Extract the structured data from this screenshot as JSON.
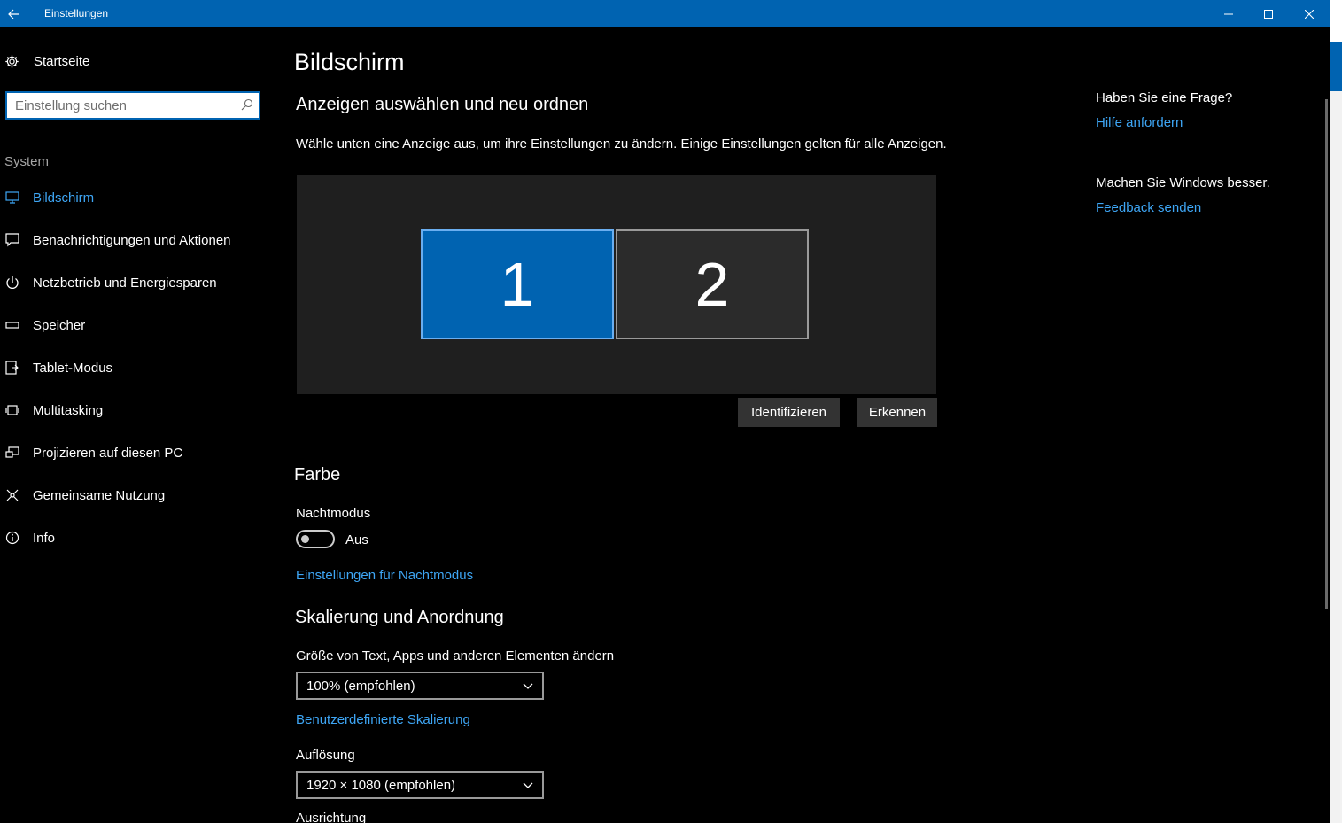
{
  "window": {
    "title": "Einstellungen"
  },
  "sidebar": {
    "home_label": "Startseite",
    "search_placeholder": "Einstellung suchen",
    "section": "System",
    "items": [
      {
        "label": "Bildschirm",
        "icon": "monitor-icon"
      },
      {
        "label": "Benachrichtigungen und Aktionen",
        "icon": "notification-icon"
      },
      {
        "label": "Netzbetrieb und Energiesparen",
        "icon": "power-icon"
      },
      {
        "label": "Speicher",
        "icon": "storage-icon"
      },
      {
        "label": "Tablet-Modus",
        "icon": "tablet-icon"
      },
      {
        "label": "Multitasking",
        "icon": "multitasking-icon"
      },
      {
        "label": "Projizieren auf diesen PC",
        "icon": "project-icon"
      },
      {
        "label": "Gemeinsame Nutzung",
        "icon": "share-icon"
      },
      {
        "label": "Info",
        "icon": "info-icon"
      }
    ]
  },
  "main": {
    "title": "Bildschirm",
    "arrange_heading": "Anzeigen auswählen und neu ordnen",
    "arrange_desc": "Wähle unten eine Anzeige aus, um ihre Einstellungen zu ändern. Einige Einstellungen gelten für alle Anzeigen.",
    "monitors": [
      "1",
      "2"
    ],
    "identify_label": "Identifizieren",
    "detect_label": "Erkennen",
    "color_heading": "Farbe",
    "night_mode_label": "Nachtmodus",
    "night_mode_state": "Aus",
    "night_mode_link": "Einstellungen für Nachtmodus",
    "scale_heading": "Skalierung und Anordnung",
    "scale_label": "Größe von Text, Apps und anderen Elementen ändern",
    "scale_value": "100% (empfohlen)",
    "custom_scale_link": "Benutzerdefinierte Skalierung",
    "resolution_label": "Auflösung",
    "resolution_value": "1920 × 1080 (empfohlen)",
    "orientation_label": "Ausrichtung"
  },
  "help": {
    "question": "Haben Sie eine Frage?",
    "help_link": "Hilfe anfordern",
    "improve": "Machen Sie Windows besser.",
    "feedback_link": "Feedback senden"
  },
  "colors": {
    "accent": "#0063b1",
    "link": "#3ea6f5",
    "background": "#000000"
  }
}
